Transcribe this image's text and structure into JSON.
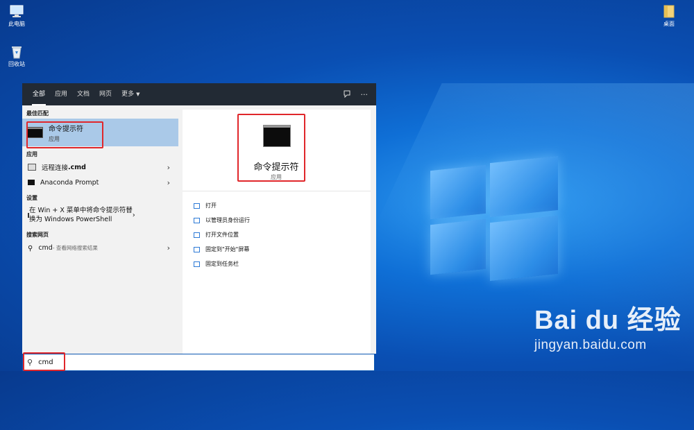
{
  "desktop": {
    "icons": [
      {
        "label": "此电脑",
        "icon": "computer-icon"
      },
      {
        "label": "回收站",
        "icon": "recycle-bin-icon"
      },
      {
        "label": "桌面",
        "icon": "folder-icon"
      }
    ],
    "watermark": {
      "brand": "Bai du 经验",
      "url": "jingyan.baidu.com"
    }
  },
  "start_menu": {
    "tabs": [
      "全部",
      "应用",
      "文档",
      "网页",
      "更多"
    ],
    "active_tab": "全部",
    "toolbar_icons": [
      "feedback-icon",
      "more-options-icon"
    ],
    "toolbar_more": "···",
    "sections": {
      "best_match": "最佳匹配",
      "apps": "应用",
      "settings": "设置",
      "web": "搜索网页"
    },
    "best_match": {
      "title": "命令提示符",
      "subtitle": "应用"
    },
    "apps": [
      {
        "label_main": "远程连接",
        "label_bold": ".cmd"
      },
      {
        "label_main": "Anaconda Prompt"
      }
    ],
    "settings": {
      "line1": "在 Win + X 菜单中将命令提示符替",
      "line2": "换为 Windows PowerShell"
    },
    "web": {
      "query": "cmd",
      "hint": " - 查看网络搜索结果"
    },
    "preview": {
      "title": "命令提示符",
      "subtitle": "应用",
      "actions": [
        "打开",
        "以管理员身份运行",
        "打开文件位置",
        "固定到\"开始\"屏幕",
        "固定到任务栏"
      ]
    },
    "search": {
      "value": "cmd"
    }
  },
  "colors": {
    "highlight": "#e0262a",
    "selected_row": "#aac9e8",
    "topbar": "#222a34"
  }
}
